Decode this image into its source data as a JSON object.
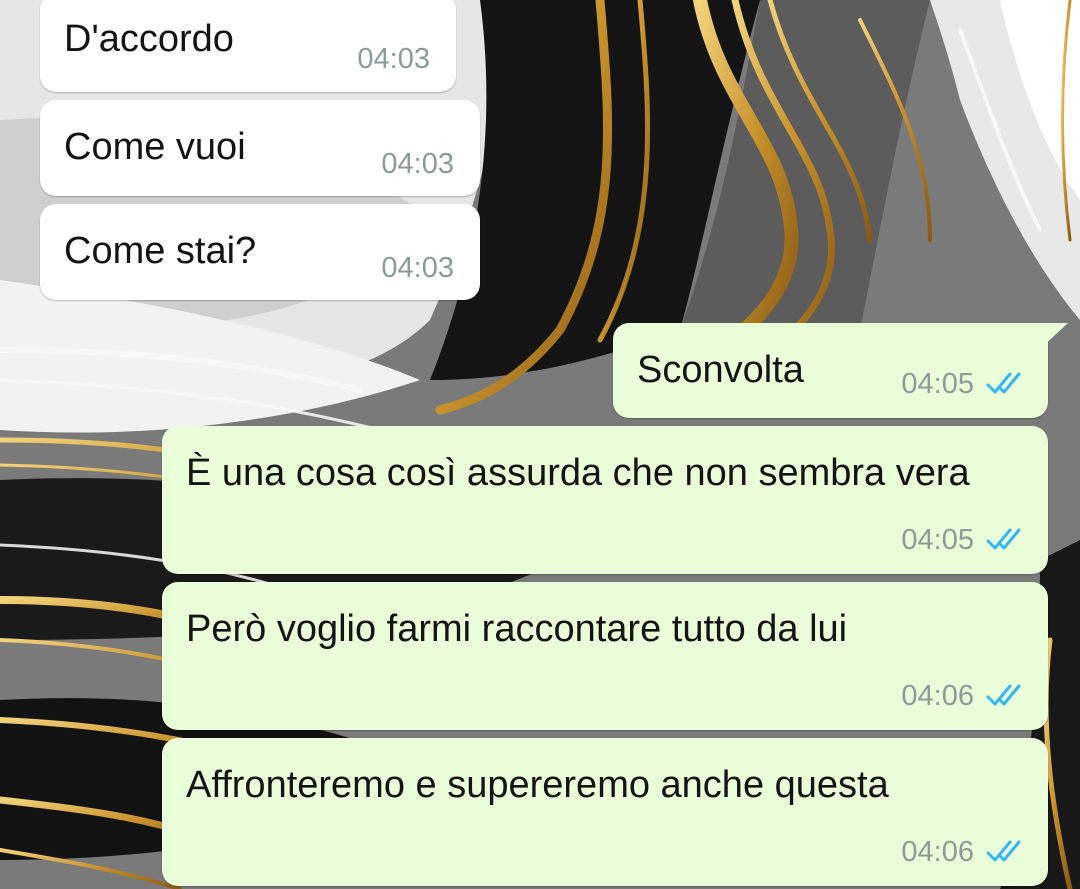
{
  "colors": {
    "incoming_bubble": "#ffffff",
    "outgoing_bubble": "#e9fdd8",
    "text": "#141414",
    "timestamp": "#8e9a98",
    "read_ticks": "#34b7f1"
  },
  "icons": {
    "read_receipt": "double-check-icon"
  },
  "messages": [
    {
      "direction": "incoming",
      "text": "D'accordo",
      "time": "04:03"
    },
    {
      "direction": "incoming",
      "text": "Come vuoi",
      "time": "04:03"
    },
    {
      "direction": "incoming",
      "text": "Come stai?",
      "time": "04:03"
    },
    {
      "direction": "outgoing",
      "text": "Sconvolta",
      "time": "04:05",
      "status": "read"
    },
    {
      "direction": "outgoing",
      "text": "È una cosa così assurda che non sembra vera",
      "time": "04:05",
      "status": "read"
    },
    {
      "direction": "outgoing",
      "text": "Però voglio farmi raccontare tutto da lui",
      "time": "04:06",
      "status": "read"
    },
    {
      "direction": "outgoing",
      "text": "Affronteremo e supereremo anche questa",
      "time": "04:06",
      "status": "read"
    }
  ]
}
